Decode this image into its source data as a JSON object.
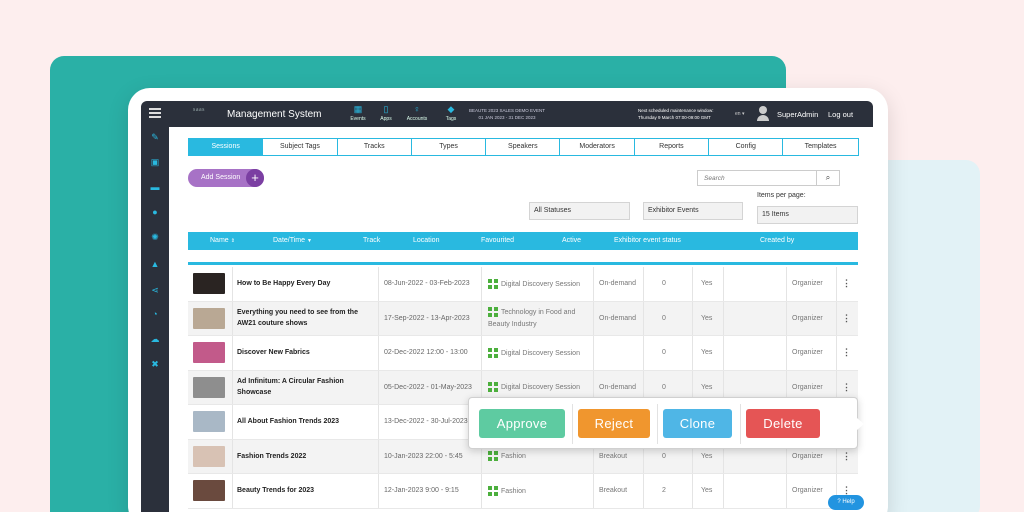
{
  "header": {
    "logo": "saas",
    "title": "Management System",
    "nav": [
      {
        "label": "Events",
        "icon": "calendar-icon"
      },
      {
        "label": "Apps",
        "icon": "phone-icon"
      },
      {
        "label": "Accounts",
        "icon": "pin-icon"
      },
      {
        "label": "Tags",
        "icon": "tag-icon"
      }
    ],
    "event_name": "BEAUTE 2023 SALES DEMO EVENT",
    "event_dates": "01 JAN 2023 - 31 DEC 2023",
    "maintenance_title": "Next scheduled maintenance window:",
    "maintenance_date": "Thursday 9 March 07:00-09:00 GMT",
    "lang": "en ▾",
    "user": "SuperAdmin",
    "logout": "Log out"
  },
  "sidebar": [
    "pencil-icon",
    "briefcase-icon",
    "bed-icon",
    "group-icon",
    "gear-icon",
    "rocket-icon",
    "share-icon",
    "chart-icon",
    "cloud-icon",
    "tools-icon"
  ],
  "tabs": [
    "Sessions",
    "Subject Tags",
    "Tracks",
    "Types",
    "Speakers",
    "Moderators",
    "Reports",
    "Config",
    "Templates"
  ],
  "add_session": "Add Session",
  "search_placeholder": "Search",
  "filters": {
    "status": "All Statuses",
    "exhibitor": "Exhibitor Events",
    "ipp_label": "Items per page:",
    "ipp_value": "15 Items"
  },
  "columns": {
    "name": "Name",
    "datetime": "Date/Time",
    "track": "Track",
    "location": "Location",
    "favourited": "Favourited",
    "active": "Active",
    "exhibitor_status": "Exhibitor event status",
    "created_by": "Created by"
  },
  "rows": [
    {
      "title": "How to Be Happy Every Day",
      "date": "08-Jun-2022 - 03-Feb-2023",
      "fav": "Digital Discovery Session",
      "type": "On-demand",
      "count": "0",
      "active": "Yes",
      "created": "Organizer",
      "thumb": "#2a2422"
    },
    {
      "title": "Everything you need to see from the AW21 couture shows",
      "date": "17-Sep-2022 - 13-Apr-2023",
      "fav": "Technology in Food and Beauty Industry",
      "type": "On-demand",
      "count": "0",
      "active": "Yes",
      "created": "Organizer",
      "thumb": "#b9a894"
    },
    {
      "title": "Discover New Fabrics",
      "date": "02-Dec-2022 12:00 - 13:00",
      "fav": "Digital Discovery Session",
      "type": "",
      "count": "0",
      "active": "Yes",
      "created": "Organizer",
      "thumb": "#c25a8a"
    },
    {
      "title": "Ad Infinitum: A Circular Fashion Showcase",
      "date": "05-Dec-2022 - 01-May-2023",
      "fav": "Digital Discovery Session",
      "type": "On-demand",
      "count": "0",
      "active": "Yes",
      "created": "Organizer",
      "thumb": "#8e8e8e"
    },
    {
      "title": "All About Fashion Trends 2023",
      "date": "13-Dec-2022 - 30-Jul-2023",
      "fav": "",
      "type": "",
      "count": "",
      "active": "",
      "created": "",
      "thumb": "#a9b8c6"
    },
    {
      "title": "Fashion Trends 2022",
      "date": "10-Jan-2023 22:00 - 5:45",
      "fav": "Fashion",
      "type": "Breakout",
      "count": "0",
      "active": "Yes",
      "created": "Organizer",
      "thumb": "#d8c2b4"
    },
    {
      "title": "Beauty Trends for 2023",
      "date": "12-Jan-2023 9:00 - 9:15",
      "fav": "Fashion",
      "type": "Breakout",
      "count": "2",
      "active": "Yes",
      "created": "Organizer",
      "thumb": "#6a4a3e"
    }
  ],
  "actions": {
    "approve": "Approve",
    "reject": "Reject",
    "clone": "Clone",
    "delete": "Delete"
  },
  "colors": {
    "approve": "#5ecba1",
    "reject": "#f0962e",
    "clone": "#4fb6e6",
    "delete": "#e55555"
  },
  "help": "Help"
}
